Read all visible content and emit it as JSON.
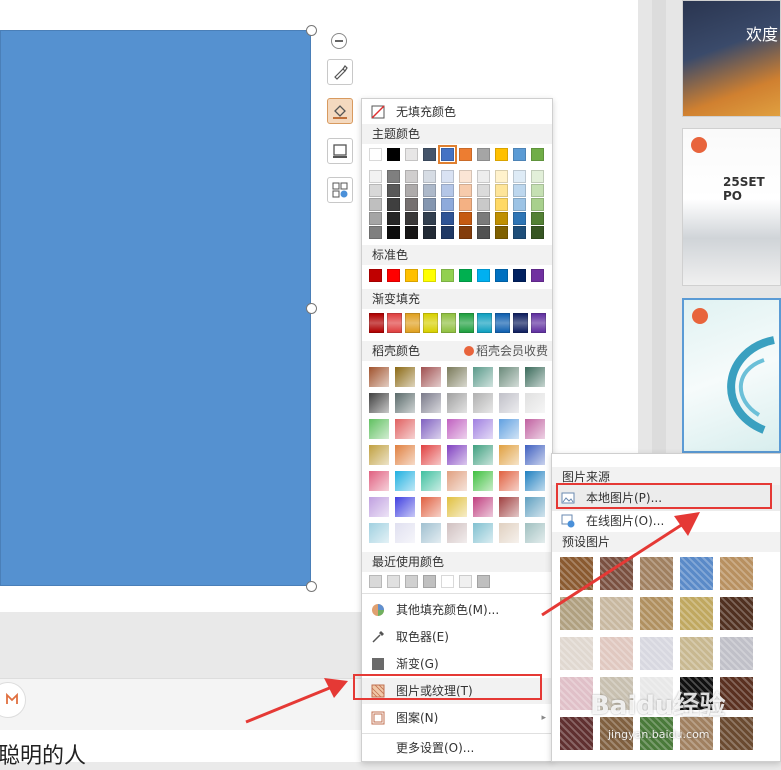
{
  "colors": {
    "shape_fill": "#5591d0",
    "accent_red": "#e53935"
  },
  "notes": {
    "text": "聪明的人"
  },
  "fill_menu": {
    "no_fill": "无填充颜色",
    "theme_title": "主题颜色",
    "standard_title": "标准色",
    "gradient_title": "渐变填充",
    "docer_title": "稻壳颜色",
    "docer_vip": "稻壳会员收费",
    "recent_title": "最近使用颜色",
    "more_colors": "其他填充颜色(M)...",
    "picker": "取色器(E)",
    "gradient": "渐变(G)",
    "picture_texture": "图片或纹理(T)",
    "pattern": "图案(N)",
    "more_settings": "更多设置(O)...",
    "theme_top": [
      "#ffffff",
      "#000000",
      "#e7e6e6",
      "#44546a",
      "#4472c4",
      "#ed7d31",
      "#a5a5a5",
      "#ffc000",
      "#5b9bd5",
      "#70ad47"
    ],
    "theme_shades": [
      [
        "#f2f2f2",
        "#7f7f7f",
        "#d0cece",
        "#d6dce4",
        "#d9e2f3",
        "#fbe5d5",
        "#ededed",
        "#fff2cc",
        "#deebf6",
        "#e2efd9"
      ],
      [
        "#d8d8d8",
        "#595959",
        "#aeabab",
        "#adb9ca",
        "#b4c6e7",
        "#f7cbac",
        "#dbdbdb",
        "#fee599",
        "#bdd7ee",
        "#c5e0b3"
      ],
      [
        "#bfbfbf",
        "#3f3f3f",
        "#757070",
        "#8496b0",
        "#8eaadb",
        "#f4b183",
        "#c9c9c9",
        "#ffd965",
        "#9cc3e5",
        "#a8d08d"
      ],
      [
        "#a5a5a5",
        "#262626",
        "#3a3838",
        "#323f4f",
        "#2f5496",
        "#c55a11",
        "#7b7b7b",
        "#bf8f00",
        "#2e75b5",
        "#538135"
      ],
      [
        "#7f7f7f",
        "#0c0c0c",
        "#171616",
        "#222a35",
        "#1f3864",
        "#833c0b",
        "#525252",
        "#7f6000",
        "#1e4e79",
        "#375623"
      ]
    ],
    "standard": [
      "#c00000",
      "#ff0000",
      "#ffc000",
      "#ffff00",
      "#92d050",
      "#00b050",
      "#00b0f0",
      "#0070c0",
      "#002060",
      "#7030a0"
    ],
    "gradient_row": [
      "#b00000",
      "#e04040",
      "#e0a020",
      "#d8d000",
      "#90c040",
      "#20a040",
      "#10a0c0",
      "#1060b0",
      "#102060",
      "#6030a0"
    ],
    "docer": [
      [
        "#a0522d",
        "#8b6914",
        "#a05050",
        "#7a7a5a",
        "#5a9a8a",
        "#6a8a7a",
        "#3a6a5a",
        "#ffffff"
      ],
      [
        "#404040",
        "#5a6a6a",
        "#7a7a8a",
        "#a0a0a0",
        "#b0b0b0",
        "#c0c0c8",
        "#e0e0e0",
        "#ffffff"
      ],
      [
        "#60c060",
        "#e06060",
        "#8060c0",
        "#c060c0",
        "#a080e0",
        "#60a0e0",
        "#c060a0",
        "#ffffff"
      ],
      [
        "#c0a040",
        "#e08040",
        "#e04040",
        "#8040c0",
        "#40a080",
        "#e0a040",
        "#4060c0",
        "#ffffff"
      ],
      [
        "#e06080",
        "#20b0e0",
        "#40c0a0",
        "#e0a080",
        "#40c040",
        "#e06040",
        "#2080c0",
        "#ffffff"
      ],
      [
        "#c0a0e0",
        "#4040e0",
        "#e06040",
        "#e0c040",
        "#c04080",
        "#a04040",
        "#60a0c0",
        "#ffffff"
      ],
      [
        "#a0d0e0",
        "#e0e0f0",
        "#a0c0d0",
        "#d0c0c0",
        "#80c0d0",
        "#e0d0c0",
        "#a0c0c0",
        "#ffffff"
      ]
    ],
    "recent": [
      "#d9d9d9",
      "#e0e0e0",
      "#d0d0d0",
      "#c0c0c0",
      "#ffffff",
      "#f0f0f0",
      "#bfbfbf"
    ]
  },
  "picture_menu": {
    "source_title": "图片来源",
    "local": "本地图片(P)...",
    "online": "在线图片(O)...",
    "preset_title": "预设图片",
    "textures": [
      "#8a5a30",
      "#7a5040",
      "#a08060",
      "#5a8ac8",
      "#b89060",
      "#b0a080",
      "#c8b8a0",
      "#b09060",
      "#c0a860",
      "#503020",
      "#e0d8d0",
      "#e0c8c0",
      "#d8d8e0",
      "#c8b890",
      "#c0c0c8",
      "#e0c0c8",
      "#c8c0b0",
      "#e8e8e8",
      "#101010",
      "#5a3020",
      "#603030",
      "#806040",
      "#4a7a3a",
      "#a08060",
      "#6a4a30"
    ]
  },
  "thumbs": {
    "t1": "欢度",
    "t2": "25SET PO",
    "t4": "PO"
  },
  "watermark": {
    "main": "Baidu经验",
    "sub": "jingyan.baidu.com"
  }
}
